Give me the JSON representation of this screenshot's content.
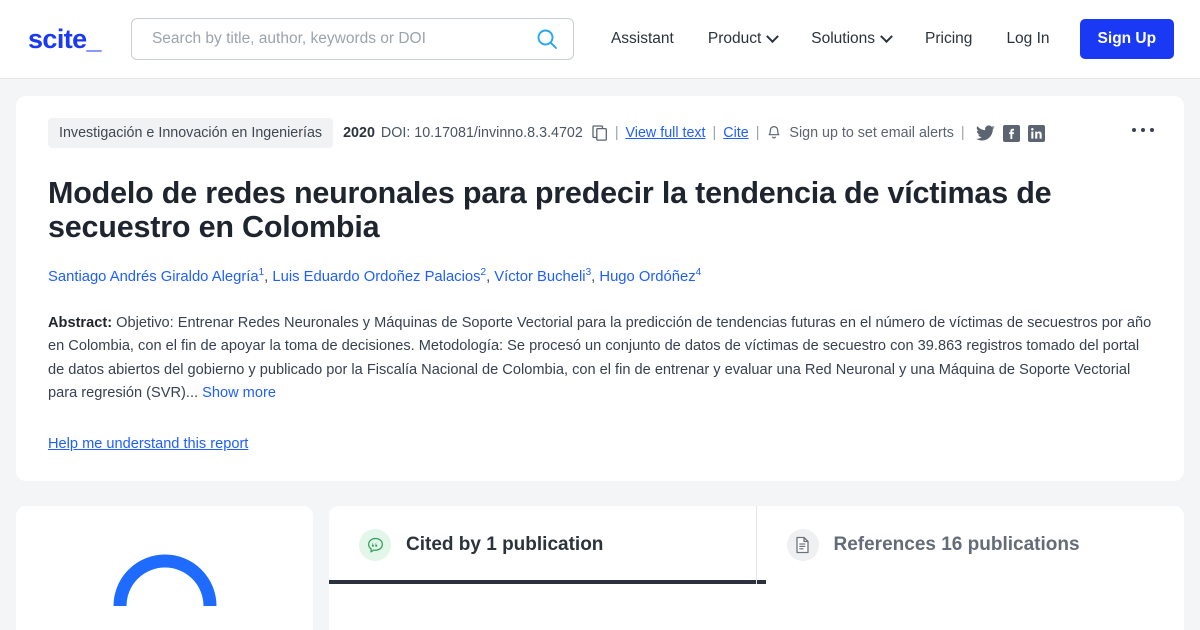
{
  "header": {
    "logo": "scite_",
    "search": {
      "placeholder": "Search by title, author, keywords or DOI",
      "value": "",
      "icon": "search-icon"
    },
    "nav": [
      {
        "label": "Assistant",
        "has_chevron": false
      },
      {
        "label": "Product",
        "has_chevron": true
      },
      {
        "label": "Solutions",
        "has_chevron": true
      },
      {
        "label": "Pricing",
        "has_chevron": false
      },
      {
        "label": "Log In",
        "has_chevron": false
      }
    ],
    "signup_label": "Sign Up",
    "accent_color": "#1a39f5"
  },
  "article": {
    "journal": "Investigación e Innovación en Ingenierías",
    "year": "2020",
    "doi_label": "DOI: 10.17081/invinno.8.3.4702",
    "copy_icon": "copy-icon",
    "view_full_text": "View full text",
    "cite": "Cite",
    "bell_icon": "bell-icon",
    "email_alerts": "Sign up to set email alerts",
    "separator": "|",
    "social": [
      {
        "name": "twitter-icon",
        "label": "Twitter"
      },
      {
        "name": "facebook-icon",
        "label": "Facebook"
      },
      {
        "name": "linkedin-icon",
        "label": "LinkedIn"
      }
    ],
    "overflow_menu": "more-options",
    "title": "Modelo de redes neuronales para predecir la tendencia de víctimas de secuestro en Colombia",
    "authors": [
      {
        "name": "Santiago Andrés Giraldo Alegría",
        "affiliation": "1"
      },
      {
        "name": "Luis Eduardo Ordoñez Palacios",
        "affiliation": "2"
      },
      {
        "name": "Víctor Bucheli",
        "affiliation": "3"
      },
      {
        "name": "Hugo Ordóñez",
        "affiliation": "4"
      }
    ],
    "abstract_label": "Abstract:",
    "abstract_text": "Objetivo: Entrenar Redes Neuronales y Máquinas de Soporte Vectorial para la predicción de tendencias futuras en el número de víctimas de secuestros por año en Colombia, con el fin de apoyar la toma de decisiones. Metodología: Se procesó un conjunto de datos de víctimas de secuestro con 39.863 registros tomado del portal de datos abiertos del gobierno y publicado por la Fiscalía Nacional de Colombia, con el fin de entrenar y evaluar una Red Neuronal y una Máquina de Soporte Vectorial para regresión (SVR)...",
    "show_more": "Show more",
    "help_link": "Help me understand this report"
  },
  "bottom": {
    "gauge": {
      "name": "citation-gauge",
      "arc_color": "#1f6bff"
    },
    "tabs": [
      {
        "label": "Cited by 1 publication",
        "icon": "quote-bubble-icon",
        "active": true
      },
      {
        "label": "References 16 publications",
        "icon": "document-icon",
        "active": false
      }
    ]
  }
}
